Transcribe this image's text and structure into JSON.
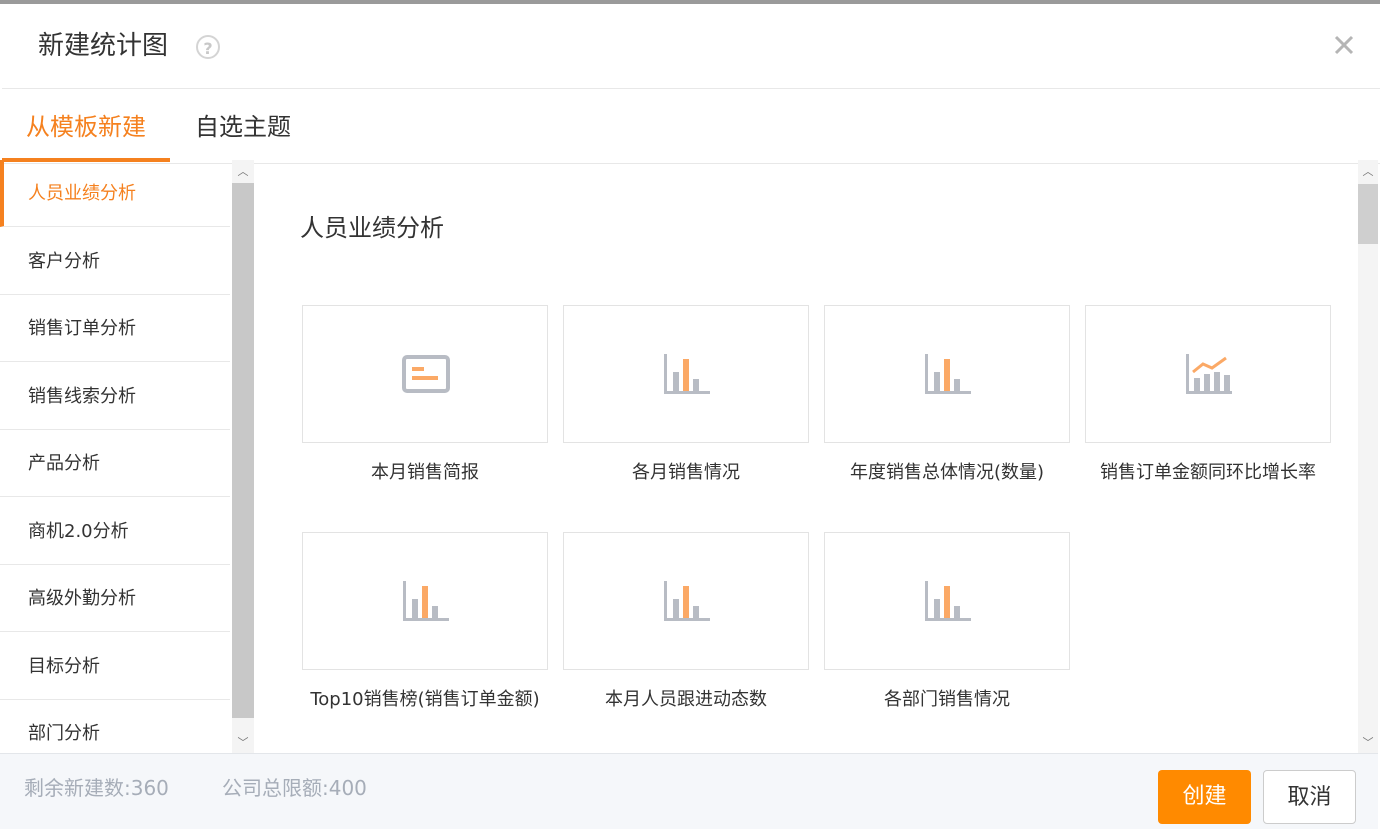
{
  "dialog": {
    "title": "新建统计图",
    "help_icon": "question-circle-icon",
    "close_icon": "close-icon"
  },
  "tabs": [
    {
      "label": "从模板新建",
      "active": true
    },
    {
      "label": "自选主题",
      "active": false
    }
  ],
  "sidebar": {
    "items": [
      {
        "label": "人员业绩分析",
        "active": true
      },
      {
        "label": "客户分析"
      },
      {
        "label": "销售订单分析"
      },
      {
        "label": "销售线索分析"
      },
      {
        "label": "产品分析"
      },
      {
        "label": "商机2.0分析"
      },
      {
        "label": "高级外勤分析"
      },
      {
        "label": "目标分析"
      },
      {
        "label": "部门分析"
      }
    ]
  },
  "main": {
    "section_title": "人员业绩分析",
    "cards": [
      {
        "label": "本月销售简报",
        "icon": "report-card-icon"
      },
      {
        "label": "各月销售情况",
        "icon": "bar-chart-icon"
      },
      {
        "label": "年度销售总体情况(数量)",
        "icon": "bar-chart-icon"
      },
      {
        "label": "销售订单金额同环比增长率",
        "icon": "line-bar-chart-icon"
      },
      {
        "label": "Top10销售榜(销售订单金额)",
        "icon": "bar-chart-icon"
      },
      {
        "label": "本月人员跟进动态数",
        "icon": "bar-chart-icon"
      },
      {
        "label": "各部门销售情况",
        "icon": "bar-chart-icon"
      }
    ]
  },
  "footer": {
    "remaining": "剩余新建数:360",
    "limit": "公司总限额:400",
    "create_label": "创建",
    "cancel_label": "取消"
  },
  "colors": {
    "accent": "#f5811f",
    "primary_button": "#ff8a00",
    "icon_gray": "#b8bcc4",
    "icon_orange": "#fba966"
  }
}
